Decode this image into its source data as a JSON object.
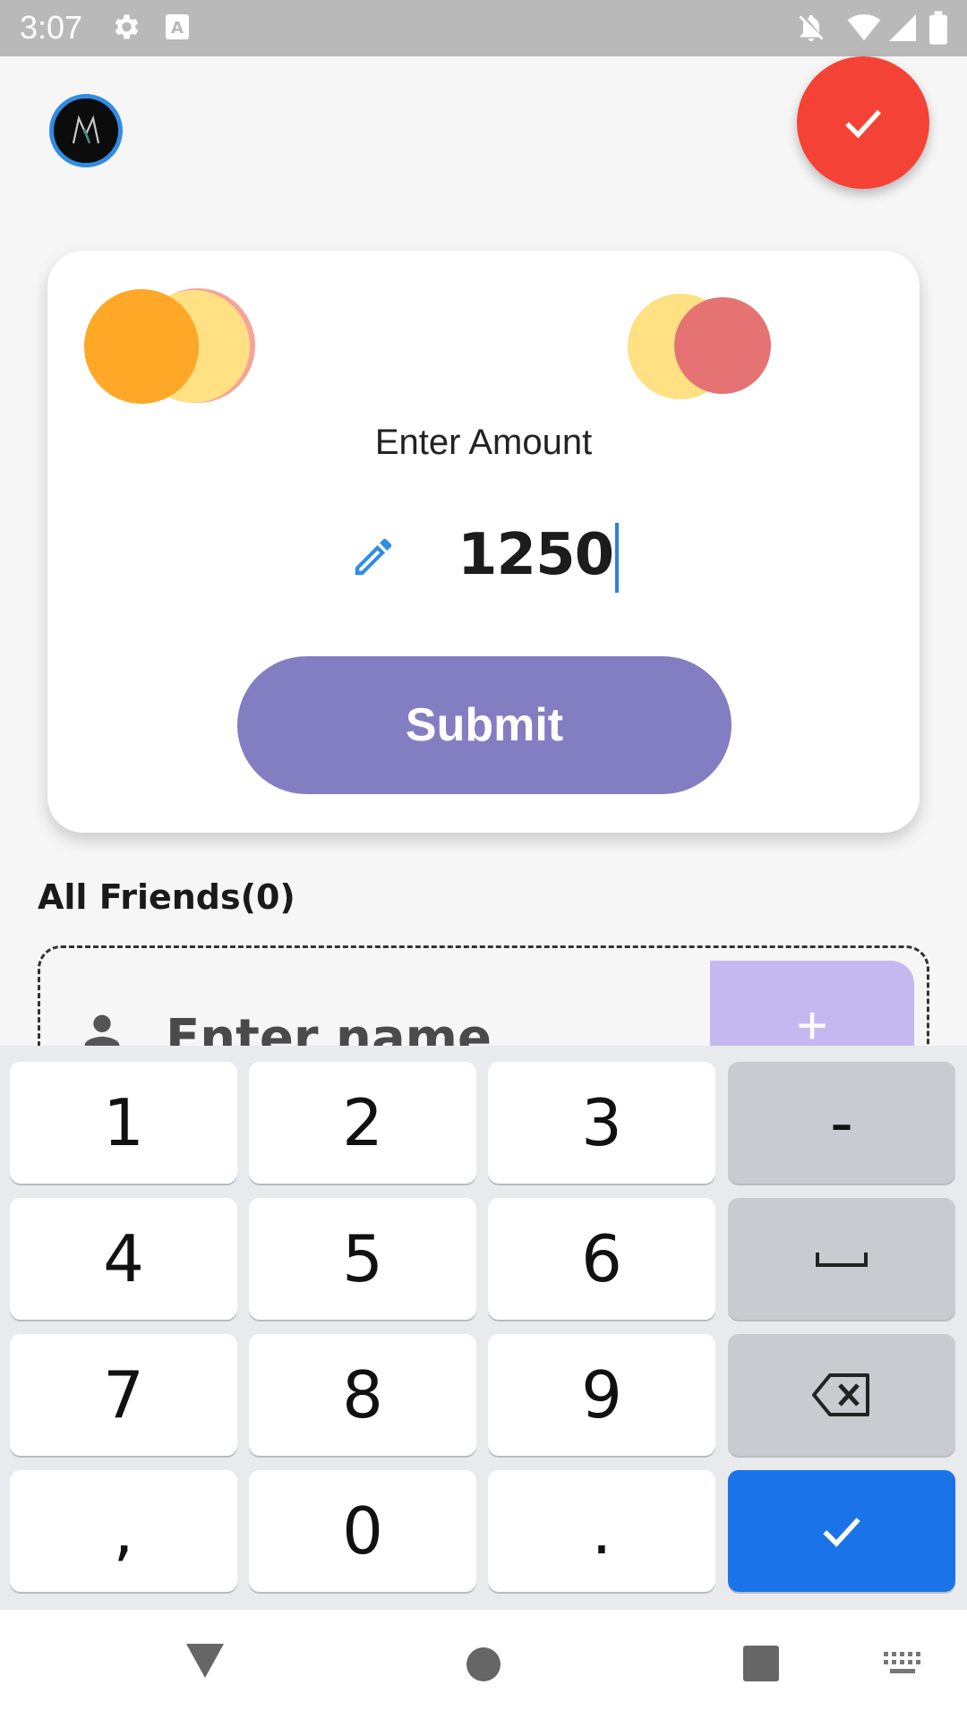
{
  "status_bar": {
    "time": "3:07",
    "icons": [
      "settings-icon",
      "a-badge-icon",
      "notifications-off-icon",
      "wifi-icon",
      "cell-signal-icon",
      "battery-icon"
    ]
  },
  "header": {
    "avatar_letter": "M",
    "confirm_icon": "check-icon",
    "accent_red": "#f44336"
  },
  "amount_card": {
    "label": "Enter Amount",
    "amount_value": "1250",
    "submit_label": "Submit",
    "submit_color": "#837ec1"
  },
  "friends": {
    "title": "All Friends(0)",
    "name_placeholder": "Enter name",
    "add_label": "+"
  },
  "keyboard": {
    "rows": [
      [
        "1",
        "2",
        "3",
        "-"
      ],
      [
        "4",
        "5",
        "6",
        "␣"
      ],
      [
        "7",
        "8",
        "9",
        "⌫"
      ],
      [
        ",",
        "0",
        ".",
        "✓"
      ]
    ],
    "enter_color": "#1a73e8"
  },
  "nav_bar": {
    "icons": [
      "back-icon",
      "home-icon",
      "recents-icon",
      "keyboard-switch-icon"
    ]
  }
}
